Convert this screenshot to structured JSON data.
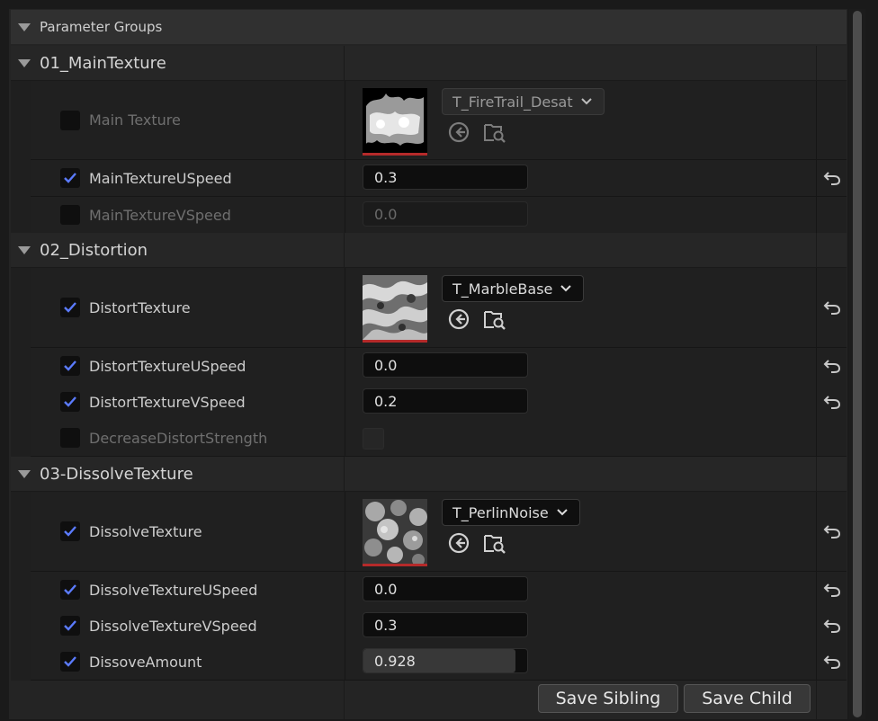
{
  "header": {
    "title": "Parameter Groups"
  },
  "colors": {
    "accent_check": "#5b7bff",
    "thumb_underline": "#b52a2a"
  },
  "groups": [
    {
      "title": "01_MainTexture",
      "props": [
        {
          "name": "Main Texture",
          "type": "texture",
          "checked": false,
          "texture": "T_FireTrail_Desat",
          "reset": false
        },
        {
          "name": "MainTextureUSpeed",
          "type": "number",
          "checked": true,
          "value": "0.3",
          "reset": true
        },
        {
          "name": "MainTextureVSpeed",
          "type": "number",
          "checked": false,
          "value": "0.0",
          "reset": false
        }
      ]
    },
    {
      "title": "02_Distortion",
      "props": [
        {
          "name": "DistortTexture",
          "type": "texture",
          "checked": true,
          "texture": "T_MarbleBase",
          "reset": true
        },
        {
          "name": "DistortTextureUSpeed",
          "type": "number",
          "checked": true,
          "value": "0.0",
          "reset": true
        },
        {
          "name": "DistortTextureVSpeed",
          "type": "number",
          "checked": true,
          "value": "0.2",
          "reset": true
        },
        {
          "name": "DecreaseDistortStrength",
          "type": "bool",
          "checked": false,
          "reset": false
        }
      ]
    },
    {
      "title": "03-DissolveTexture",
      "props": [
        {
          "name": "DissolveTexture",
          "type": "texture",
          "checked": true,
          "texture": "T_PerlinNoise",
          "reset": true
        },
        {
          "name": "DissolveTextureUSpeed",
          "type": "number",
          "checked": true,
          "value": "0.0",
          "reset": true
        },
        {
          "name": "DissolveTextureVSpeed",
          "type": "number",
          "checked": true,
          "value": "0.3",
          "reset": true
        },
        {
          "name": "DissoveAmount",
          "type": "slider",
          "checked": true,
          "value": "0.928",
          "fraction": 0.928,
          "reset": true
        }
      ]
    }
  ],
  "buttons": {
    "save_sibling": "Save Sibling",
    "save_child": "Save Child"
  },
  "icons": {
    "expand": "triangle-down-icon",
    "check": "check-icon",
    "dropdown": "chevron-down-icon",
    "use_selected": "arrow-left-circle-icon",
    "browse": "folder-search-icon",
    "reset": "reset-arrow-icon"
  }
}
